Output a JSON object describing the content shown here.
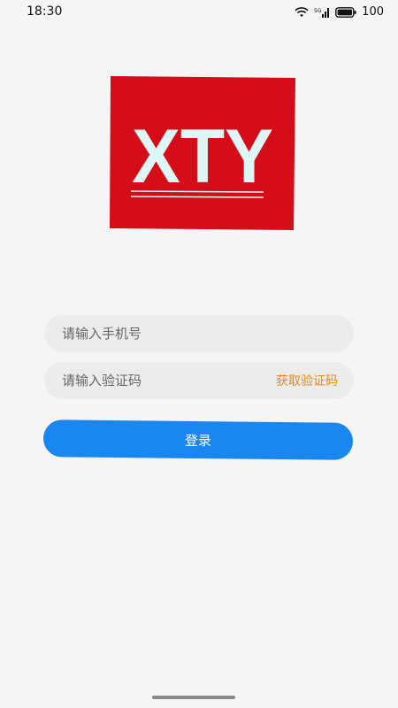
{
  "status_bar": {
    "time": "18:30",
    "battery": "100"
  },
  "logo": {
    "text": "XTY",
    "background_color": "#d40d18",
    "text_color": "#dff6f6"
  },
  "form": {
    "phone_placeholder": "请输入手机号",
    "phone_value": "",
    "code_placeholder": "请输入验证码",
    "code_value": "",
    "get_code_label": "获取验证码",
    "login_label": "登录"
  },
  "colors": {
    "accent": "#1a86f0",
    "link": "#e48a1c"
  }
}
